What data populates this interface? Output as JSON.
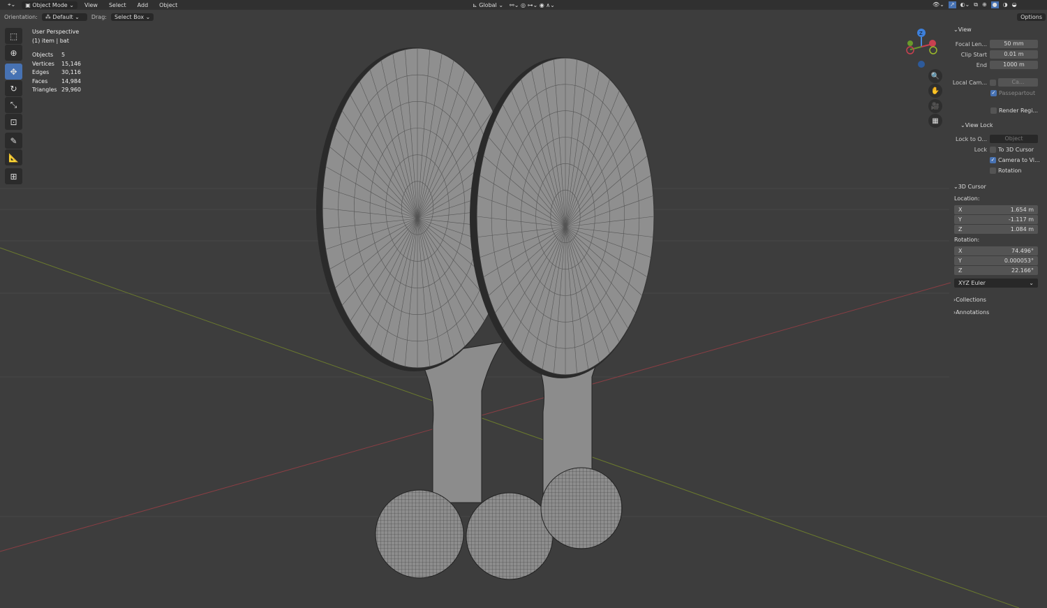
{
  "header": {
    "mode": "Object Mode",
    "menus": [
      "View",
      "Select",
      "Add",
      "Object"
    ],
    "transform_orientation": "Global"
  },
  "toolbar2": {
    "orientation_label": "Orientation:",
    "orientation_value": "Default",
    "drag_label": "Drag:",
    "drag_value": "Select Box",
    "options": "Options"
  },
  "overlay": {
    "perspective": "User Perspective",
    "selection": "(1) item | bat",
    "stats": [
      {
        "k": "Objects",
        "v": "5"
      },
      {
        "k": "Vertices",
        "v": "15,146"
      },
      {
        "k": "Edges",
        "v": "30,116"
      },
      {
        "k": "Faces",
        "v": "14,984"
      },
      {
        "k": "Triangles",
        "v": "29,960"
      }
    ]
  },
  "panel": {
    "view": {
      "title": "View",
      "focal_label": "Focal Len...",
      "focal": "50 mm",
      "clip_start_label": "Clip Start",
      "clip_start": "0.01 m",
      "end_label": "End",
      "end": "1000 m",
      "local_cam_label": "Local Cam...",
      "local_cam_value": "Ca...",
      "passepartout": "Passepartout",
      "render_region": "Render Regi..."
    },
    "view_lock": {
      "title": "View Lock",
      "lock_to_label": "Lock to O...",
      "lock_to_placeholder": "Object",
      "lock_label": "Lock",
      "to_cursor": "To 3D Cursor",
      "camera_to_view": "Camera to Vi...",
      "rotation": "Rotation"
    },
    "cursor": {
      "title": "3D Cursor",
      "location_label": "Location:",
      "loc": [
        {
          "a": "X",
          "v": "1.654 m"
        },
        {
          "a": "Y",
          "v": "-1.117 m"
        },
        {
          "a": "Z",
          "v": "1.084 m"
        }
      ],
      "rotation_label": "Rotation:",
      "rot": [
        {
          "a": "X",
          "v": "74.496°"
        },
        {
          "a": "Y",
          "v": "0.000053°"
        },
        {
          "a": "Z",
          "v": "22.166°"
        }
      ],
      "mode": "XYZ Euler"
    },
    "collections": "Collections",
    "annotations": "Annotations"
  },
  "gizmo": {
    "z": "Z",
    "x": "X",
    "y": "Y"
  }
}
